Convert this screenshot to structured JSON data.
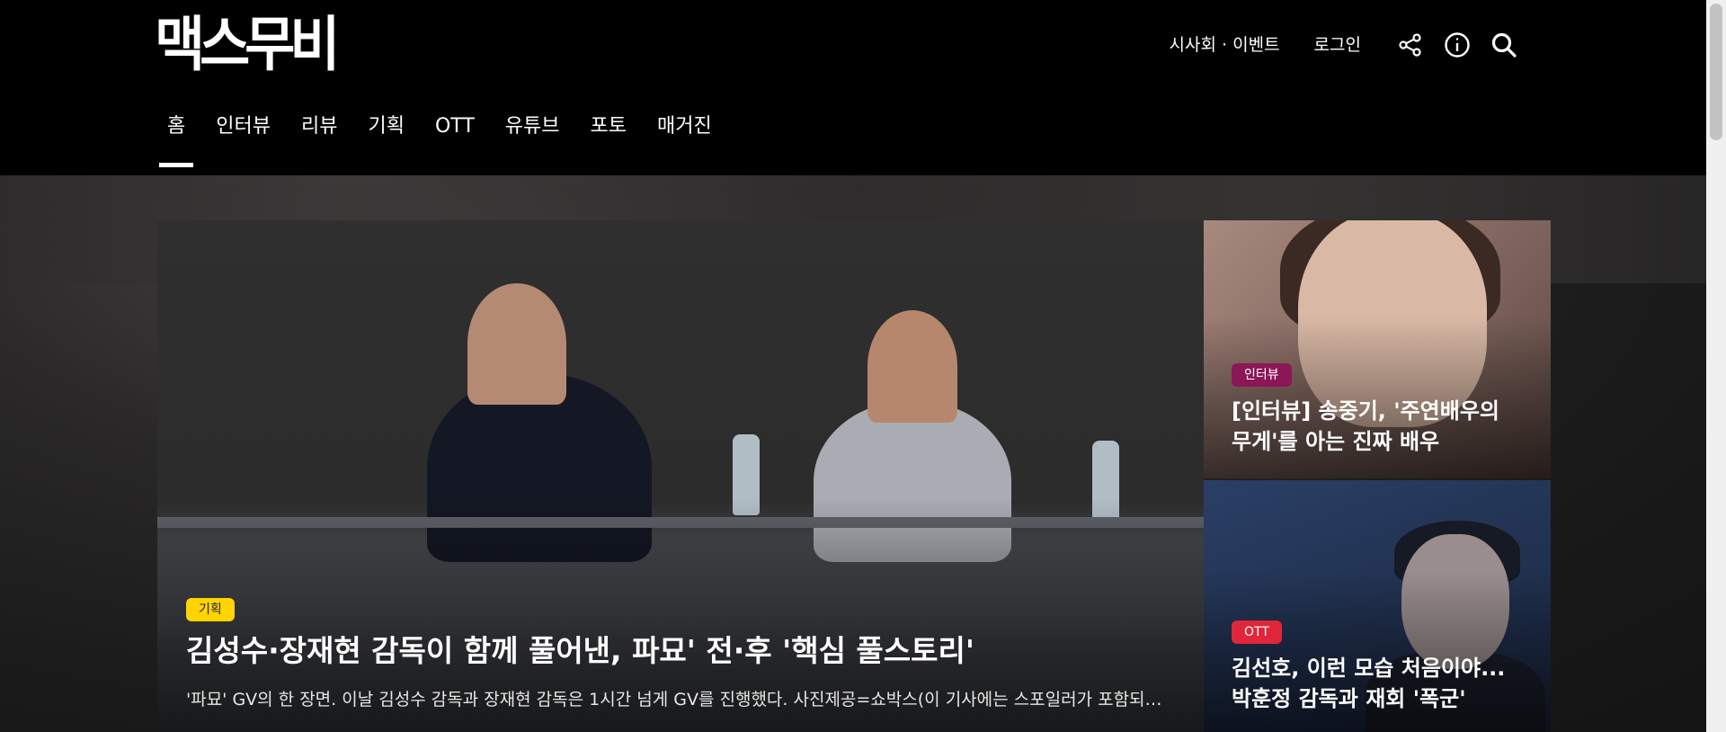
{
  "brand": {
    "logo_text": "맥스무비"
  },
  "header": {
    "links": [
      {
        "label": "시사회 · 이벤트"
      },
      {
        "label": "로그인"
      }
    ],
    "icons": [
      "share-icon",
      "info-icon",
      "search-icon"
    ]
  },
  "nav": {
    "items": [
      {
        "label": "홈",
        "active": true
      },
      {
        "label": "인터뷰"
      },
      {
        "label": "리뷰"
      },
      {
        "label": "기획"
      },
      {
        "label": "OTT"
      },
      {
        "label": "유튜브"
      },
      {
        "label": "포토"
      },
      {
        "label": "매거진"
      }
    ]
  },
  "feature": {
    "category": "기획",
    "title": "김성수·장재현 감독이 함께 풀어낸, 파묘' 전·후 '핵심 풀스토리'",
    "subtitle": "'파묘' GV의 한 장면. 이날 김성수 감독과 장재현 감독은 1시간 넘게 GV를 진행했다. 사진제공=쇼박스(이 기사에는 스포일러가 포함되어 있습니다)"
  },
  "side_cards": [
    {
      "category": "인터뷰",
      "title_line1": "[인터뷰] 송중기, '주연배우의",
      "title_line2": "무게'를 아는 진짜 배우"
    },
    {
      "category": "OTT",
      "title_line1": "김선호, 이런 모습 처음이야...",
      "title_line2": "박훈정 감독과 재회 '폭군'"
    }
  ],
  "colors": {
    "badge_feature": "#ffd400",
    "badge_interview": "#8c1657",
    "badge_ott": "#e0263a"
  }
}
